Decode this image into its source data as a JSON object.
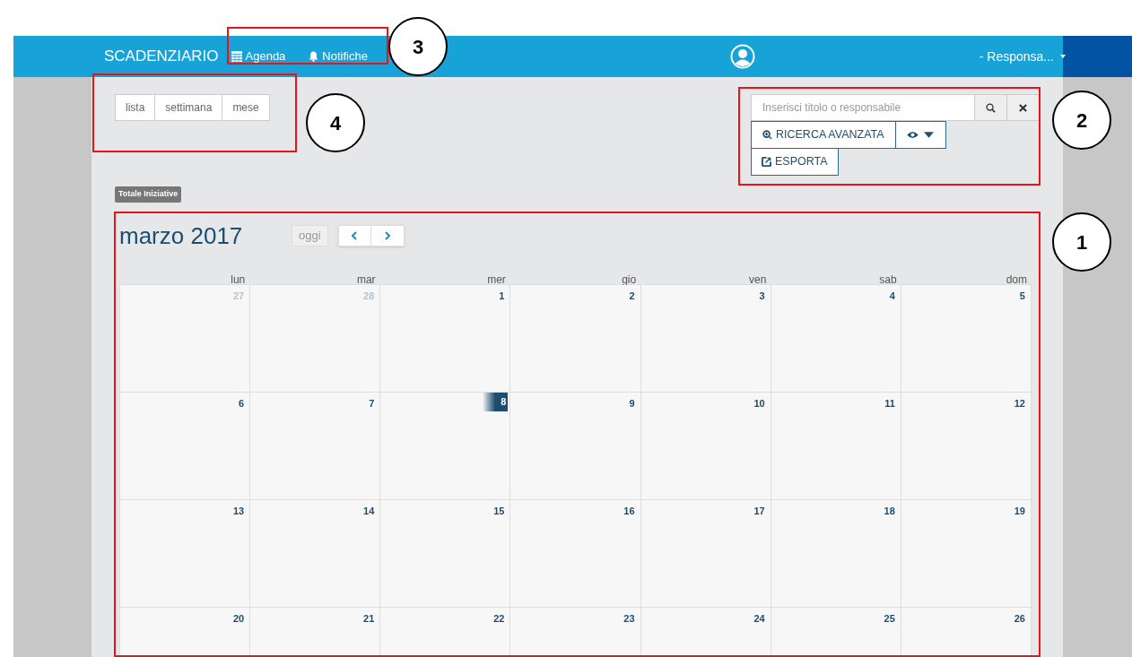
{
  "header": {
    "brand": "SCADENZIARIO",
    "nav": [
      "Agenda",
      "Notifiche"
    ],
    "user": "- Responsa..."
  },
  "views": [
    "lista",
    "settimana",
    "mese"
  ],
  "badge": "Totale Iniziative",
  "search": {
    "placeholder": "Inserisci titolo o responsabile",
    "advanced": "RICERCA AVANZATA",
    "export": "ESPORTA"
  },
  "calendar": {
    "title": "marzo 2017",
    "today_button": "oggi",
    "weekdays": [
      "lun",
      "mar",
      "mer",
      "gio",
      "ven",
      "sab",
      "dom"
    ],
    "weeks": [
      [
        {
          "day": "27",
          "other_month": true,
          "today": false
        },
        {
          "day": "28",
          "other_month": true,
          "today": false
        },
        {
          "day": "1",
          "other_month": false,
          "today": false
        },
        {
          "day": "2",
          "other_month": false,
          "today": false
        },
        {
          "day": "3",
          "other_month": false,
          "today": false
        },
        {
          "day": "4",
          "other_month": false,
          "today": false
        },
        {
          "day": "5",
          "other_month": false,
          "today": false
        }
      ],
      [
        {
          "day": "6",
          "other_month": false,
          "today": false
        },
        {
          "day": "7",
          "other_month": false,
          "today": false
        },
        {
          "day": "8",
          "other_month": false,
          "today": true
        },
        {
          "day": "9",
          "other_month": false,
          "today": false
        },
        {
          "day": "10",
          "other_month": false,
          "today": false
        },
        {
          "day": "11",
          "other_month": false,
          "today": false
        },
        {
          "day": "12",
          "other_month": false,
          "today": false
        }
      ],
      [
        {
          "day": "13",
          "other_month": false,
          "today": false
        },
        {
          "day": "14",
          "other_month": false,
          "today": false
        },
        {
          "day": "15",
          "other_month": false,
          "today": false
        },
        {
          "day": "16",
          "other_month": false,
          "today": false
        },
        {
          "day": "17",
          "other_month": false,
          "today": false
        },
        {
          "day": "18",
          "other_month": false,
          "today": false
        },
        {
          "day": "19",
          "other_month": false,
          "today": false
        }
      ],
      [
        {
          "day": "20",
          "other_month": false,
          "today": false
        },
        {
          "day": "21",
          "other_month": false,
          "today": false
        },
        {
          "day": "22",
          "other_month": false,
          "today": false
        },
        {
          "day": "23",
          "other_month": false,
          "today": false
        },
        {
          "day": "24",
          "other_month": false,
          "today": false
        },
        {
          "day": "25",
          "other_month": false,
          "today": false
        },
        {
          "day": "26",
          "other_month": false,
          "today": false
        }
      ]
    ]
  },
  "annotations": [
    "3",
    "4",
    "2",
    "1"
  ]
}
